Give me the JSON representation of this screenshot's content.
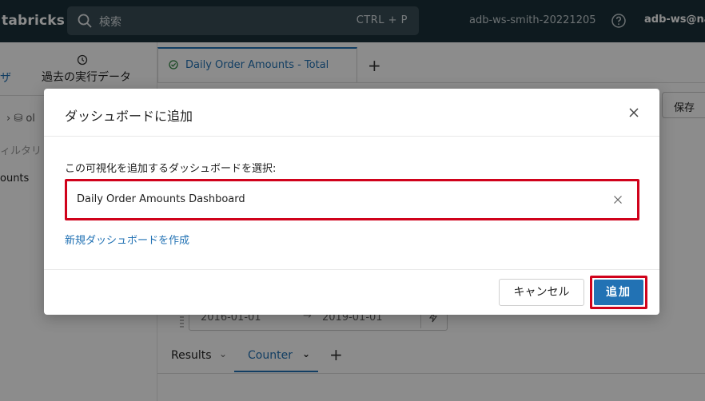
{
  "topbar": {
    "brand": "tabricks",
    "search_placeholder": "検索",
    "search_shortcut": "CTRL + P",
    "workspace": "adb-ws-smith-20221205",
    "user": "adb-ws@na"
  },
  "left_pane": {
    "active_tab": "ザ",
    "history_tab": "過去の実行データ",
    "selector": "› ⛁ ol",
    "filter_placeholder": "ィルタリ",
    "item": "ounts"
  },
  "editor": {
    "tab_label": "Daily Order Amounts - Total",
    "new_tab": "+",
    "save": "保存"
  },
  "params": {
    "start": "2016-01-01",
    "arrow": "→",
    "end": "2019-01-01"
  },
  "results": {
    "tab1": "Results",
    "tab2": "Counter",
    "add": "+"
  },
  "modal": {
    "title": "ダッシュボードに追加",
    "field_label": "この可視化を追加するダッシュボードを選択:",
    "selected_dashboard": "Daily Order Amounts Dashboard",
    "new_dashboard_link": "新規ダッシュボードを作成",
    "cancel": "キャンセル",
    "add": "追加"
  },
  "colors": {
    "topbar_bg": "#1b3139",
    "accent_blue": "#2272b4",
    "highlight_red": "#d0021b"
  }
}
